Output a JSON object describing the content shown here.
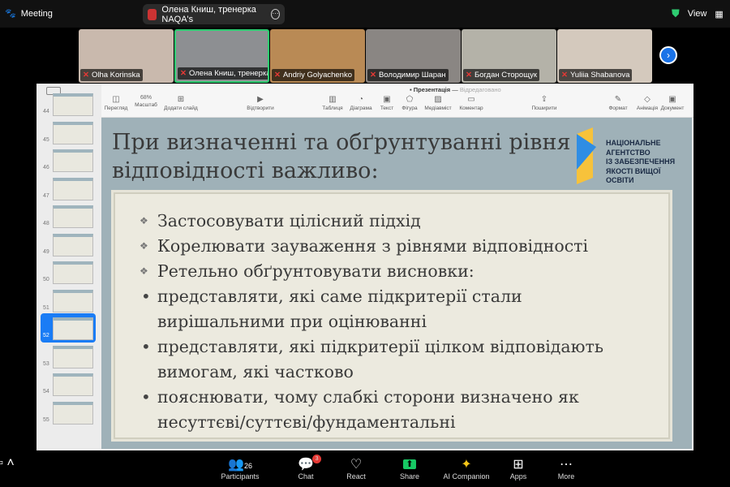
{
  "topbar": {
    "meeting_label": "Meeting",
    "speaker": "Олена Книш, тренерка NAQA's",
    "view_label": "View"
  },
  "participants_strip": [
    {
      "name": "Olha Korinska",
      "bg": "#c9b9ad"
    },
    {
      "name": "Олена Книш, тренерка N...",
      "bg": "#8d8f92",
      "active": true
    },
    {
      "name": "Andriy Golyachenko",
      "bg": "#b98a55"
    },
    {
      "name": "Володимир Шаран",
      "bg": "#8a8683"
    },
    {
      "name": "Богдан Сторощук",
      "bg": "#b4b2a8"
    },
    {
      "name": "Yuliia Shabanova",
      "bg": "#d4c9bd"
    }
  ],
  "keynote": {
    "doc_title": "Презентація",
    "doc_status": "Відредаговано",
    "toolbar": [
      "Перегляд",
      "Масштаб",
      "Додати слайд",
      "Відтворити",
      "Таблиця",
      "Діаграма",
      "Текст",
      "Фігура",
      "Медіавміст",
      "Коментар",
      "Поширити",
      "Формат",
      "Анімація",
      "Документ"
    ],
    "zoom_value": "68%",
    "slide_numbers": [
      "44",
      "45",
      "46",
      "47",
      "48",
      "49",
      "50",
      "51",
      "52",
      "53",
      "54",
      "55"
    ],
    "selected_slide": "52"
  },
  "slide": {
    "title_line1": "При визначенні та обґрунтуванні рівня",
    "title_line2": "відповідності важливо:",
    "logo_text": [
      "НАЦІОНАЛЬНЕ",
      "АГЕНТСТВО",
      "ІЗ ЗАБЕЗПЕЧЕННЯ",
      "ЯКОСТІ ВИЩОЇ ОСВІТИ"
    ],
    "bullets": [
      {
        "text": "Застосовувати цілісний підхід",
        "type": "diamond"
      },
      {
        "text": "Корелювати зауваження з рівнями відповідності",
        "type": "diamond"
      },
      {
        "text": "Ретельно обґрунтовувати висновки:",
        "type": "diamond"
      },
      {
        "text": "представляти, які саме підкритерії стали вирішальними при оцінюванні",
        "type": "dot"
      },
      {
        "text": "представляти, які підкритерії цілком відповідають вимогам, які частково",
        "type": "dot"
      },
      {
        "text": "пояснювати, чому слабкі сторони визначено як несуттєві/суттєві/фундаментальні",
        "type": "dot"
      }
    ]
  },
  "bottombar": {
    "participants_label": "Participants",
    "participants_count": "26",
    "chat_label": "Chat",
    "chat_badge": "3",
    "react_label": "React",
    "share_label": "Share",
    "ai_label": "AI Companion",
    "apps_label": "Apps",
    "more_label": "More"
  },
  "colors": {
    "active_border": "#2ecc71",
    "share_green": "#17c964",
    "badge_red": "#e53935",
    "next_blue": "#1a73e8",
    "selected_blue": "#1a7cf5"
  }
}
